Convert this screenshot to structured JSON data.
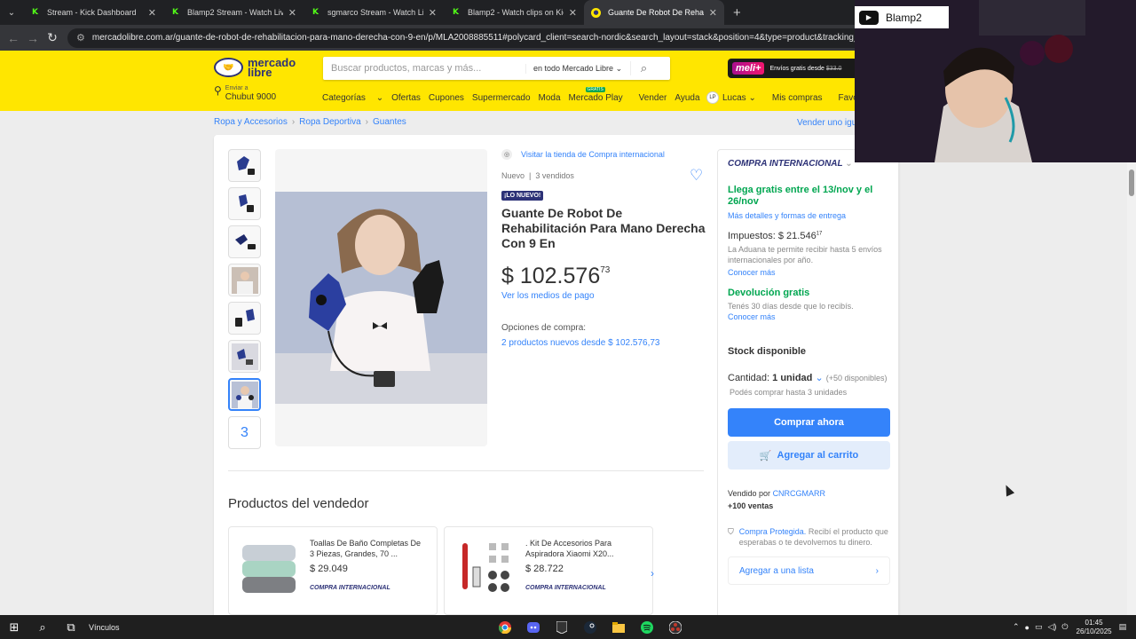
{
  "browser": {
    "tabs": [
      {
        "title": "Stream - Kick Dashboard",
        "icon": "kick"
      },
      {
        "title": "Blamp2 Stream - Watch Live on",
        "icon": "kick"
      },
      {
        "title": "sgmarco Stream - Watch Live o",
        "icon": "kick"
      },
      {
        "title": "Blamp2 - Watch clips on Kick",
        "icon": "kick"
      },
      {
        "title": "Guante De Robot De Rehabilita",
        "icon": "mercadolibre",
        "active": true
      }
    ],
    "url": "mercadolibre.com.ar/guante-de-robot-de-rehabilitacion-para-mano-derecha-con-9-en/p/MLA2008885511#polycard_client=search-nordic&search_layout=stack&position=4&type=product&tracking_id=c3c11"
  },
  "header": {
    "logo_line1": "mercado",
    "logo_line2": "libre",
    "search_placeholder": "Buscar productos, marcas y más...",
    "search_scope": "en todo Mercado Libre",
    "meli_badge": "meli+",
    "meli_text": "Envíos gratis desde",
    "meli_amount": "$33.0",
    "location_label": "Enviar a",
    "location_value": "Chubut 9000",
    "nav": [
      "Categorías",
      "Ofertas",
      "Cupones",
      "Supermercado",
      "Moda",
      "Mercado Play",
      "Vender",
      "Ayuda"
    ],
    "nav_badge": "GRATIS",
    "user_initials": "LP",
    "user_name": "Lucas",
    "my_purchases": "Mis compras",
    "favorites": "Favoritos"
  },
  "breadcrumb": [
    "Ropa y Accesorios",
    "Ropa Deportiva",
    "Guantes"
  ],
  "sell_one": "Vender uno igual",
  "product": {
    "visit_store": "Visitar la tienda de Compra internacional",
    "condition": "Nuevo",
    "sold": "3 vendidos",
    "badge": "¡LO NUEVO!",
    "title": "Guante De Robot De Rehabilitación Para Mano Derecha Con 9 En",
    "price_int": "$ 102.576",
    "price_cents": "73",
    "payment_link": "Ver los medios de pago",
    "options_label": "Opciones de compra:",
    "options_link": "2 productos nuevos desde $ 102.576,73",
    "thumb_more": "3"
  },
  "buybox": {
    "shipping_type": "COMPRA INTERNACIONAL",
    "arrives_prefix": "Llega gratis entre el",
    "arrives_from": "13/nov",
    "arrives_mid": "y el",
    "arrives_to": "26/nov",
    "details_link": "Más detalles y formas de entrega",
    "taxes_label": "Impuestos:",
    "taxes_value": "$ 21.546",
    "taxes_cents": "17",
    "customs_note": "La Aduana te permite recibir hasta 5 envíos internacionales por año.",
    "know_more_1": "Conocer más",
    "return_title": "Devolución gratis",
    "return_note": "Tenés 30 días desde que lo recibís.",
    "know_more_2": "Conocer más",
    "stock": "Stock disponible",
    "qty_label": "Cantidad:",
    "qty_value": "1 unidad",
    "qty_avail": "(+50 disponibles)",
    "qty_limit": "Podés comprar hasta 3 unidades",
    "buy_now": "Comprar ahora",
    "add_cart": "Agregar al carrito",
    "seller_label": "Vendido por",
    "seller_name": "CNRCGMARR",
    "sales": "+100 ventas",
    "protected_title": "Compra Protegida.",
    "protected_text": "Recibí el producto que esperabas o te devolvemos tu dinero.",
    "add_list": "Agregar a una lista"
  },
  "seller_products": {
    "heading": "Productos del vendedor",
    "items": [
      {
        "title": "Toallas De Baño Completas De 3 Piezas, Grandes, 70 ...",
        "price": "$ 29.049",
        "tag": "COMPRA INTERNACIONAL"
      },
      {
        "title": ". Kit De Accesorios Para Aspiradora Xiaomi X20...",
        "price": "$ 28.722",
        "tag": "COMPRA INTERNACIONAL"
      }
    ]
  },
  "overlay": {
    "channel": "Blamp2"
  },
  "taskbar": {
    "label": "Vínculos",
    "time": "01:45",
    "date": "26/10/2025"
  },
  "colors": {
    "ml_yellow": "#ffe600",
    "ml_blue": "#3483fa",
    "ml_green": "#00a650",
    "ml_navy": "#2d3277"
  }
}
